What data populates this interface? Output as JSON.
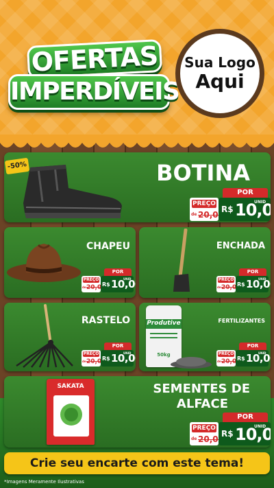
{
  "header": {
    "title_line1": "OFERTAS",
    "title_line2": "IMPERDÍVEIS",
    "logo_line1": "Sua Logo",
    "logo_line2": "Aqui"
  },
  "colors": {
    "background_orange": "#f3a52c",
    "card_green": "#2f7a27",
    "price_red": "#d42a2a",
    "price_green": "#0e5a1c",
    "banner_yellow": "#f5c518"
  },
  "products": {
    "botina": {
      "name": "BOTINA",
      "discount": "-50%",
      "por": "POR",
      "preco": "PREÇO",
      "de": "de",
      "old": "20,00",
      "rs": "R$",
      "price": "10,00",
      "unit": "UNID",
      "icon": "boot-icon"
    },
    "chapeu": {
      "name": "CHAPEU",
      "por": "POR",
      "preco": "PREÇO",
      "de": "de",
      "old": "20,00",
      "rs": "R$",
      "price": "10,00",
      "unit": "UNID",
      "icon": "hat-icon"
    },
    "enchada": {
      "name": "ENCHADA",
      "por": "POR",
      "preco": "PREÇO",
      "de": "de",
      "old": "20,00",
      "rs": "R$",
      "price": "10,00",
      "unit": "UNID",
      "icon": "hoe-icon"
    },
    "rastelo": {
      "name": "RASTELO",
      "por": "POR",
      "preco": "PREÇO",
      "de": "de",
      "old": "20,00",
      "rs": "R$",
      "price": "10,00",
      "unit": "UNID",
      "icon": "rake-icon"
    },
    "fertilizantes": {
      "name": "FERTILIZANTES",
      "bag_brand": "Produtive",
      "bag_weight": "50kg",
      "por": "POR",
      "preco": "PREÇO",
      "de": "de",
      "old": "20,00",
      "rs": "R$",
      "price": "10,00",
      "unit": "UNID",
      "icon": "fertilizer-bag-icon"
    },
    "sementes": {
      "name_line1": "SEMENTES DE",
      "name_line2": "ALFACE",
      "pack_brand": "SAKATA",
      "por": "POR",
      "preco": "PREÇO",
      "de": "de",
      "old": "20,00",
      "rs": "R$",
      "price": "10,00",
      "unit": "UNID",
      "icon": "seed-pack-icon"
    }
  },
  "banner": "Crie seu encarte com este tema!",
  "disclaimer": "*Imagens Meramente Ilustrativas"
}
